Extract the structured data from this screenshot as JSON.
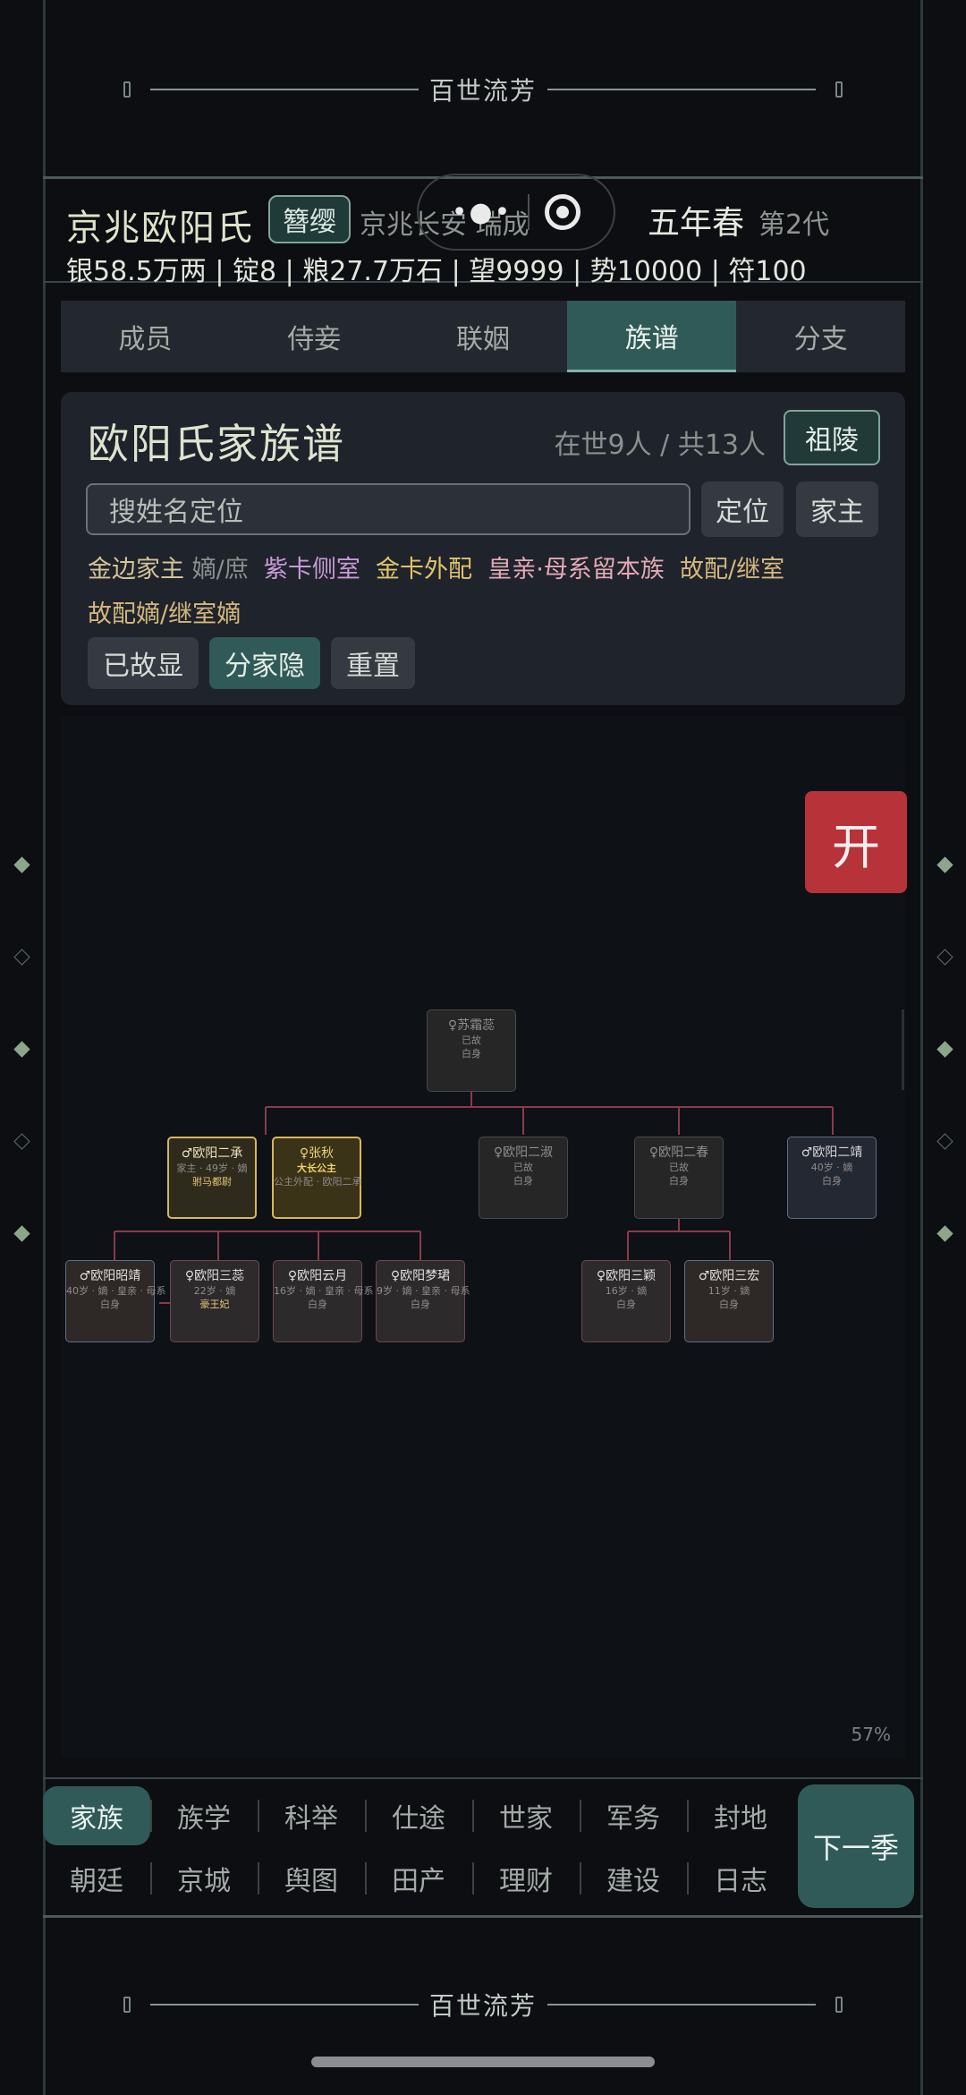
{
  "banner": {
    "title": "百世流芳"
  },
  "header": {
    "clan_name": "京兆欧阳氏",
    "rank": "簪缨",
    "place": "京兆长安",
    "era_partial": "瑞成",
    "season": "五年春",
    "generation": "第2代",
    "resources": "银58.5万两 | 锭8 | 粮27.7万石 | 望9999 | 势10000 | 符100",
    "capsule_dots": "•●•"
  },
  "tabs": [
    {
      "label": "成员"
    },
    {
      "label": "侍妾"
    },
    {
      "label": "联姻"
    },
    {
      "label": "族谱",
      "active": true
    },
    {
      "label": "分支"
    }
  ],
  "panel": {
    "title": "欧阳氏家族谱",
    "count": "在世9人 / 共13人",
    "tomb_button": "祖陵",
    "search_placeholder": "搜姓名定位",
    "locate_button": "定位",
    "head_button": "家主",
    "legend": {
      "gold_head": "金边家主",
      "main_branch": "嫡/庶",
      "purple": "紫卡侧室",
      "gold_card": "金卡外配",
      "royal": "皇亲·母系留本族",
      "deceased": "故配/继室",
      "deceased_main": "故配嫡/继室嫡"
    },
    "show_dead_button": "已故显",
    "hide_branch_button": "分家隐",
    "reset_button": "重置"
  },
  "tree": {
    "zoom": "57%",
    "open_button": "开",
    "nodes": [
      {
        "id": "n0",
        "name": "♀苏霜蕊",
        "l2": "已故",
        "l3": "白身",
        "style": "gray"
      },
      {
        "id": "n1",
        "name": "♂欧阳二承",
        "l2": "家主 · 49岁 · 嫡",
        "l3": "驸马都尉",
        "style": "gold"
      },
      {
        "id": "n2",
        "name": "♀张秋",
        "l2": "大长公主",
        "l3": "公主外配 · 欧阳二承",
        "style": "yellow"
      },
      {
        "id": "n3",
        "name": "♀欧阳二淑",
        "l2": "已故",
        "l3": "白身",
        "style": "gray"
      },
      {
        "id": "n4",
        "name": "♀欧阳二春",
        "l2": "已故",
        "l3": "白身",
        "style": "gray"
      },
      {
        "id": "n5",
        "name": "♂欧阳二靖",
        "l2": "40岁 · 嫡",
        "l3": "白身",
        "style": "blue"
      },
      {
        "id": "n6",
        "name": "♂欧阳昭靖",
        "l2": "40岁 · 嫡 · 皇亲 · 母系",
        "l3": "白身",
        "style": "bl-brown"
      },
      {
        "id": "n7",
        "name": "♀欧阳三蕊",
        "l2": "22岁 · 嫡",
        "l3": "豪王妃",
        "style": "brown"
      },
      {
        "id": "n8",
        "name": "♀欧阳云月",
        "l2": "16岁 · 嫡 · 皇亲 · 母系",
        "l3": "白身",
        "style": "brown"
      },
      {
        "id": "n9",
        "name": "♀欧阳梦珺",
        "l2": "9岁 · 嫡 · 皇亲 · 母系",
        "l3": "白身",
        "style": "brown"
      },
      {
        "id": "n10",
        "name": "♀欧阳三颖",
        "l2": "16岁 · 嫡",
        "l3": "白身",
        "style": "brown"
      },
      {
        "id": "n11",
        "name": "♂欧阳三宏",
        "l2": "11岁 · 嫡",
        "l3": "白身",
        "style": "bl-brown"
      }
    ]
  },
  "bottom_nav": {
    "row1": [
      "家族",
      "族学",
      "科举",
      "仕途",
      "世家",
      "军务",
      "封地"
    ],
    "row2": [
      "朝廷",
      "京城",
      "舆图",
      "田产",
      "理财",
      "建设",
      "日志"
    ],
    "active": "家族",
    "next_button": "下一季"
  },
  "colors": {
    "accent_teal": "#2f5a57",
    "open_red": "#b8323a",
    "gold_border": "#d9b65a",
    "line_red": "#8a3a48"
  }
}
